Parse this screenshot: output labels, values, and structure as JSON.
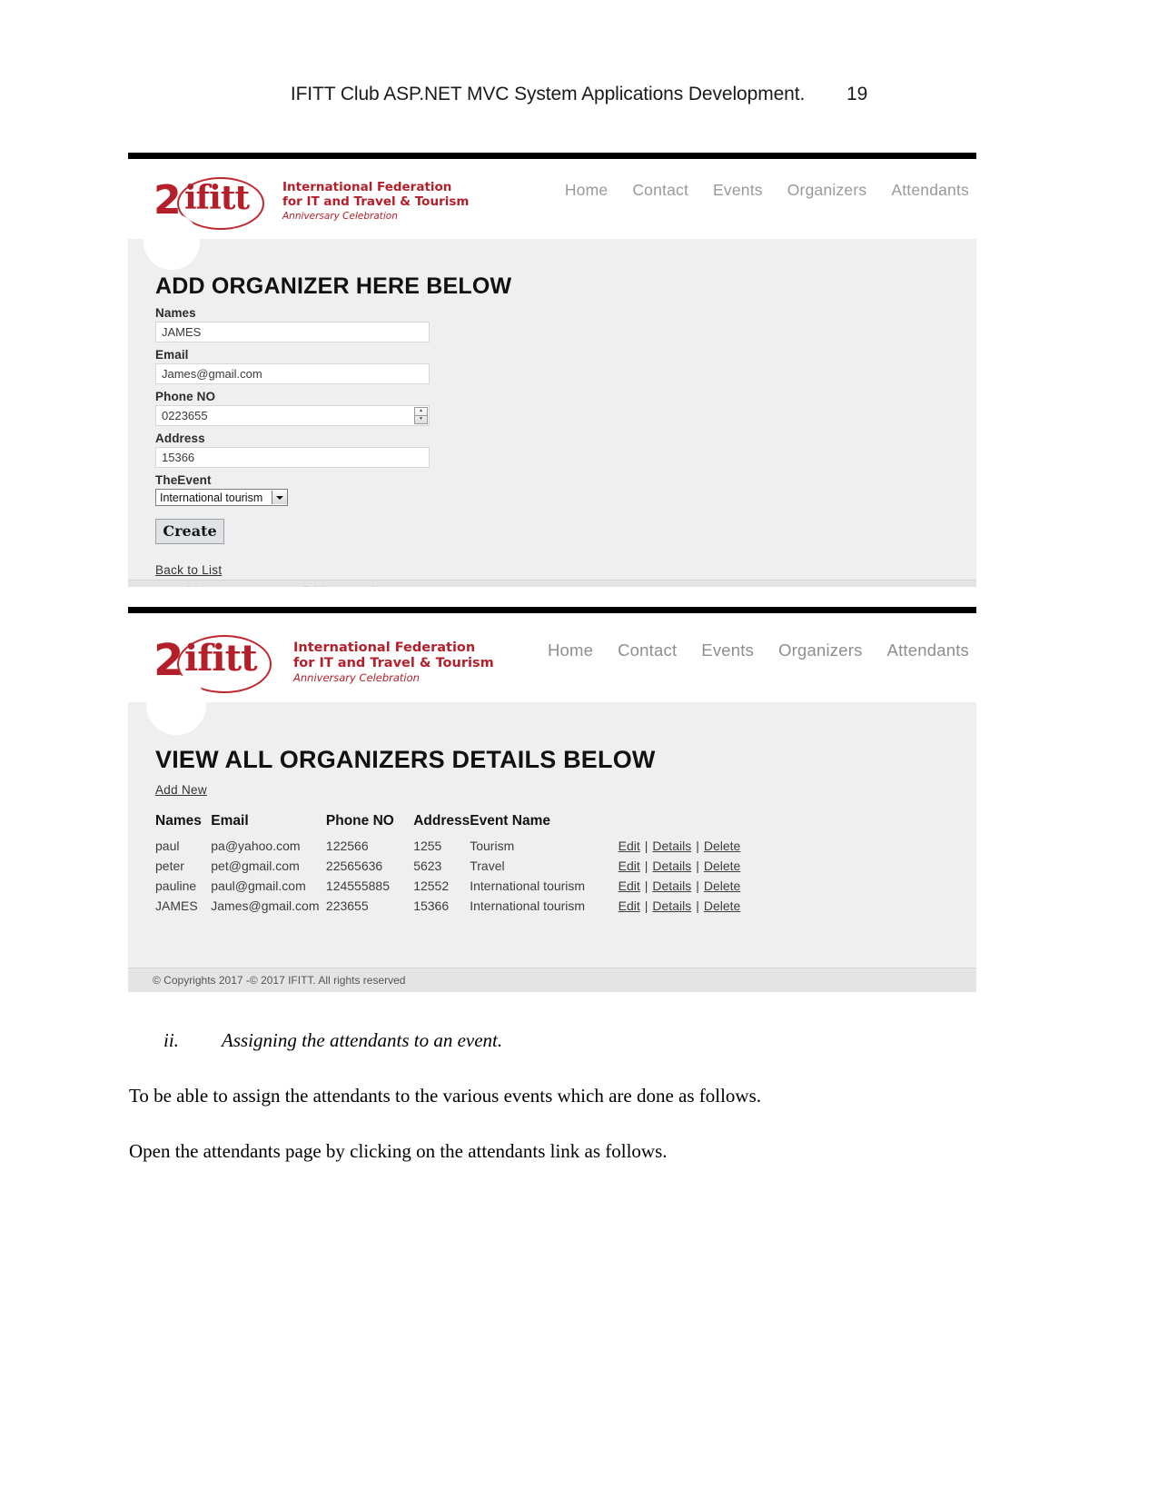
{
  "document": {
    "header_title": "IFITT  Club ASP.NET MVC System Applications Development.",
    "page_number": "19",
    "list_item_number": "ii.",
    "list_item_text": "Assigning the attendants to an event.",
    "paragraph_1": "To be able to assign the attendants to the various events which are done as follows.",
    "paragraph_2": "Open the attendants page by clicking on the attendants link as follows."
  },
  "brand": {
    "anniversary_number": "2",
    "wordmark": "ifitt",
    "line1": "International Federation",
    "line2": "for IT and Travel & Tourism",
    "line3": "Anniversary Celebration",
    "color": "#b51f2a"
  },
  "nav": {
    "items": [
      {
        "label": "Home"
      },
      {
        "label": "Contact"
      },
      {
        "label": "Events"
      },
      {
        "label": "Organizers"
      },
      {
        "label": "Attendants"
      }
    ]
  },
  "footer": {
    "copyright": "© Copyrights 2017 -© 2017 IFITT. All rights reserved"
  },
  "screenshot_create": {
    "heading": "ADD ORGANIZER HERE BELOW",
    "fields": [
      {
        "label": "Names",
        "value": "JAMES"
      },
      {
        "label": "Email",
        "value": "James@gmail.com"
      },
      {
        "label": "Phone NO",
        "value": "0223655"
      },
      {
        "label": "Address",
        "value": "15366"
      }
    ],
    "event_label": "TheEvent",
    "event_selected": "International tourism",
    "submit_label": "Create",
    "back_link": "Back to List"
  },
  "screenshot_list": {
    "heading": "VIEW ALL ORGANIZERS DETAILS BELOW",
    "add_new_label": "Add New",
    "columns": [
      "Names",
      "Email",
      "Phone NO",
      "Address",
      "Event Name"
    ],
    "actions": {
      "edit": "Edit",
      "details": "Details",
      "delete": "Delete",
      "separator": "|"
    },
    "rows": [
      {
        "name": "paul",
        "email": "pa@yahoo.com",
        "phone": "122566",
        "address": "1255",
        "event": "Tourism"
      },
      {
        "name": "peter",
        "email": "pet@gmail.com",
        "phone": "22565636",
        "address": "5623",
        "event": "Travel"
      },
      {
        "name": "pauline",
        "email": "paul@gmail.com",
        "phone": "124555885",
        "address": "12552",
        "event": "International tourism"
      },
      {
        "name": "JAMES",
        "email": "James@gmail.com",
        "phone": "223655",
        "address": "15366",
        "event": "International tourism"
      }
    ]
  }
}
